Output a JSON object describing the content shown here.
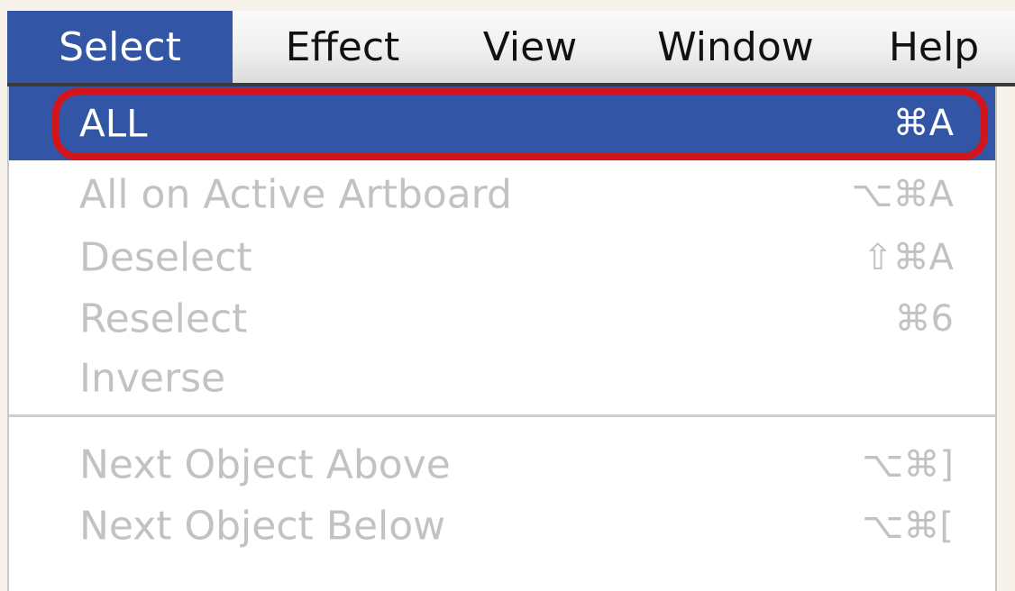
{
  "menubar": {
    "menus": [
      {
        "label": "Select"
      },
      {
        "label": "Effect"
      },
      {
        "label": "View"
      },
      {
        "label": "Window"
      },
      {
        "label": "Help"
      }
    ],
    "active_menu": "Select"
  },
  "dropdown": {
    "items": [
      {
        "label": "ALL",
        "shortcut": "⌘A",
        "state": "highlighted"
      },
      {
        "label": "All on Active Artboard",
        "shortcut": "⌥⌘A",
        "state": "disabled"
      },
      {
        "label": "Deselect",
        "shortcut": "⇧⌘A",
        "state": "disabled"
      },
      {
        "label": "Reselect",
        "shortcut": "⌘6",
        "state": "disabled"
      },
      {
        "label": "Inverse",
        "shortcut": "",
        "state": "disabled"
      },
      {
        "label": "Next Object Above",
        "shortcut": "⌥⌘]",
        "state": "disabled"
      },
      {
        "label": "Next Object Below",
        "shortcut": "⌥⌘[",
        "state": "disabled"
      }
    ]
  },
  "colors": {
    "highlight": "#3355a6",
    "annotation_ring": "#d3141c",
    "disabled_text": "#c2c2c2",
    "background": "#f7f3ea"
  }
}
